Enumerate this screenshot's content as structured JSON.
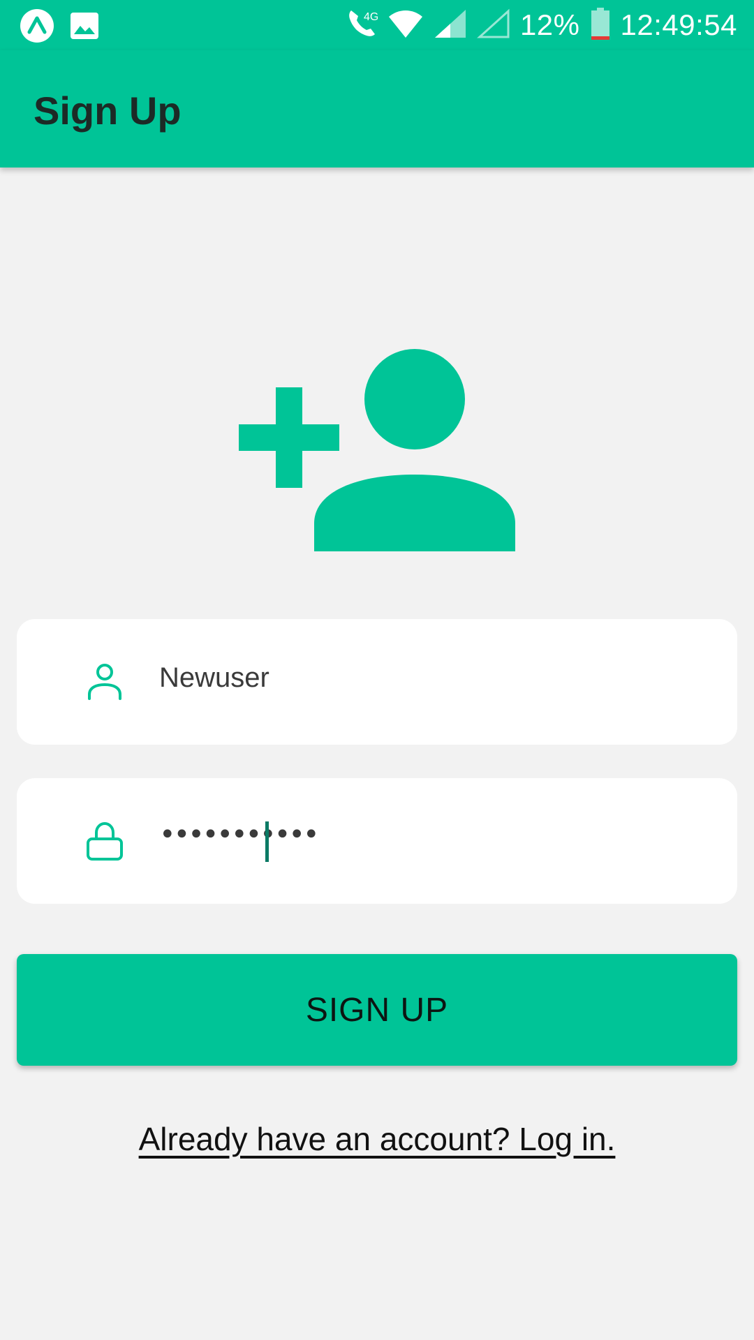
{
  "status_bar": {
    "battery_percent": "12%",
    "time": "12:49:54",
    "network_label": "4G",
    "icons": [
      "expo-icon",
      "image-icon",
      "wifi-call-icon",
      "wifi-icon",
      "signal-icon",
      "signal-empty-icon",
      "battery-low-icon"
    ],
    "battery_level": 0.12,
    "battery_warning_color": "#e53935"
  },
  "app_bar": {
    "title": "Sign Up"
  },
  "hero": {
    "icon": "person-add-icon"
  },
  "form": {
    "username": {
      "icon": "user-icon",
      "value": "Newuser"
    },
    "password": {
      "icon": "lock-icon",
      "masked_value": "•••••••••••"
    },
    "submit_label": "SIGN UP",
    "login_link_text": "Already have an account? Log in."
  },
  "colors": {
    "accent": "#00c497",
    "background": "#f2f2f2",
    "field_background": "#ffffff",
    "title_text": "#1c2a26"
  }
}
